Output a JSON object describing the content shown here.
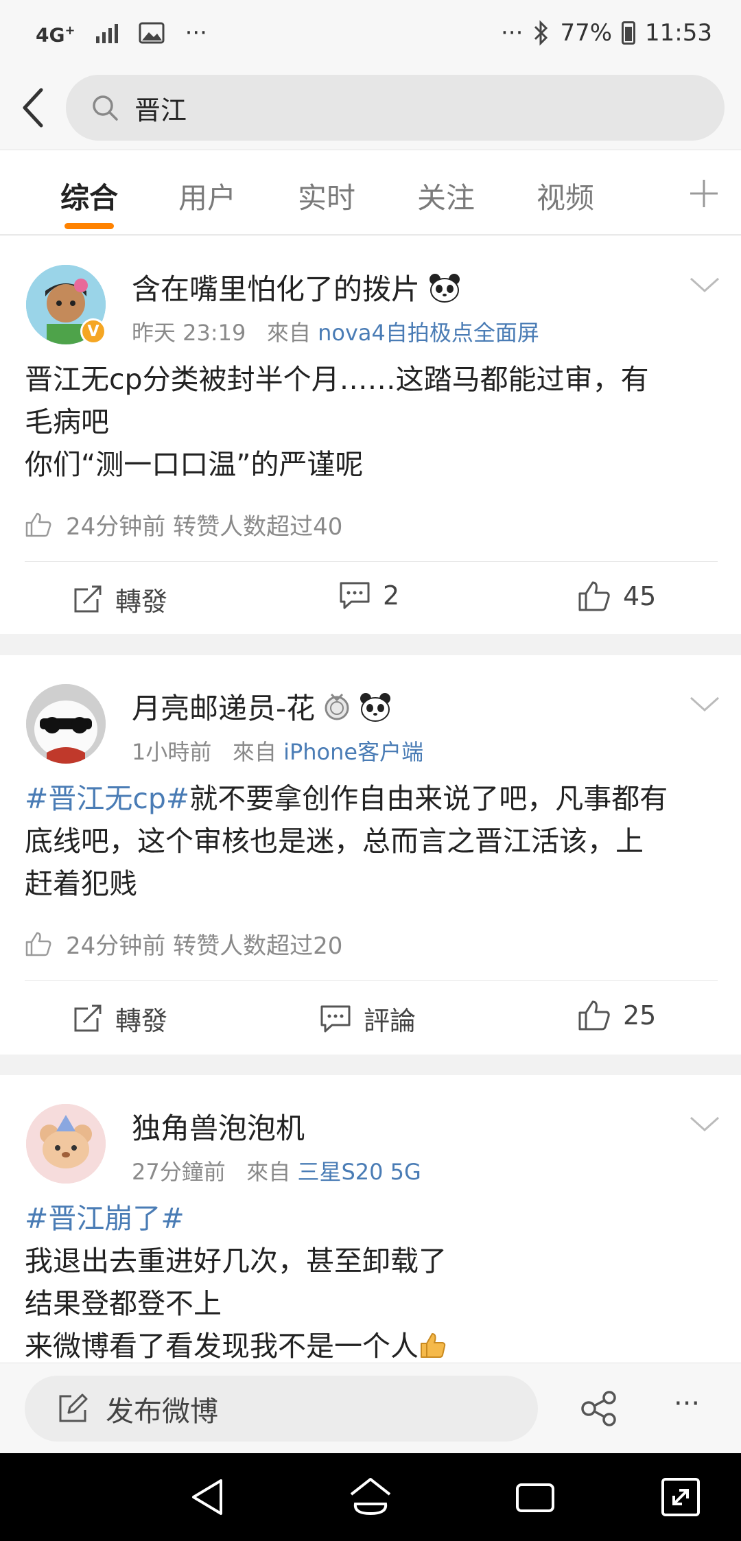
{
  "status_bar": {
    "network": "4G",
    "network_sup": "+",
    "more": "···",
    "battery": "77%",
    "time": "11:53"
  },
  "search": {
    "query": "晋江"
  },
  "tabs": [
    "综合",
    "用户",
    "实时",
    "关注",
    "视频"
  ],
  "posts": [
    {
      "username": "含在嘴里怕化了的拨片",
      "time": "昨天 23:19",
      "from_label": "來自",
      "source": "nova4自拍极点全面屏",
      "content_lines": [
        "晋江无cp分类被封半个月……这踏马都能过审，有",
        "毛病吧",
        "你们“测一口口温”的严谨呢"
      ],
      "social": "24分钟前 转赞人数超过40",
      "repost": "轉發",
      "comments": "2",
      "likes": "45"
    },
    {
      "username": "月亮邮递员-花",
      "time": "1小時前",
      "from_label": "來自",
      "source": "iPhone客户端",
      "tag": "#晋江无cp#",
      "content_lines": [
        "就不要拿创作自由来说了吧，凡事都有",
        "底线吧，这个审核也是迷，总而言之晋江活该，上",
        "赶着犯贱"
      ],
      "social": "24分钟前 转赞人数超过20",
      "repost": "轉發",
      "comments": "評論",
      "likes": "25"
    },
    {
      "username": "独角兽泡泡机",
      "time": "27分鐘前",
      "from_label": "來自",
      "source": "三星S20 5G",
      "tag": "#晋江崩了#",
      "content_lines": [
        "我退出去重进好几次，甚至卸载了",
        "结果登都登不上",
        "来微博看了看发现我不是一个人"
      ]
    }
  ],
  "bottom_bar": {
    "compose": "发布微博",
    "more": "···"
  },
  "colors": {
    "accent": "#ff8200",
    "link": "#4a7cb5",
    "verified": "#f5a623"
  }
}
